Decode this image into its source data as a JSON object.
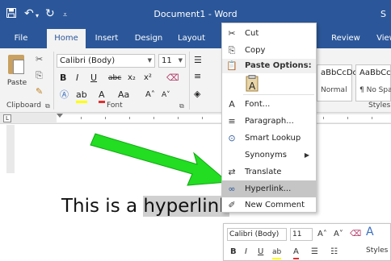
{
  "titlebar": {
    "title": "Document1  -  Word",
    "right_text": "S",
    "save_icon": "save-icon",
    "undo_icon": "undo-icon",
    "redo_icon": "redo-icon",
    "customize_icon": "customize-qat-icon"
  },
  "tabs": [
    {
      "label": "File",
      "active": false
    },
    {
      "label": "Home",
      "active": true
    },
    {
      "label": "Insert",
      "active": false
    },
    {
      "label": "Design",
      "active": false
    },
    {
      "label": "Layout",
      "active": false
    },
    {
      "label": "Review",
      "active": false
    },
    {
      "label": "View",
      "active": false
    }
  ],
  "ribbon": {
    "paste_label": "Paste",
    "clipboard_label": "Clipboard",
    "font_name": "Calibri (Body)",
    "font_size": "11",
    "font_label": "Font",
    "bold": "B",
    "italic": "I",
    "underline": "U",
    "strike": "abc",
    "subscript": "x₂",
    "superscript": "x²",
    "grow": "A˄",
    "shrink": "A˅",
    "change_case": "Aa",
    "styles_label": "Styles",
    "style1_sample": "aBbCcDc",
    "style1_name": "Normal",
    "style2_sample": "AaBbCcD",
    "style2_name": "¶ No Spac"
  },
  "document": {
    "text_before": "This is a ",
    "text_selected": "hyperlink",
    "text_after": "."
  },
  "context_menu": {
    "items": [
      {
        "label": "Cut",
        "icon": "✂"
      },
      {
        "label": "Copy",
        "icon": "⎘"
      },
      {
        "label": "Font...",
        "icon": "A"
      },
      {
        "label": "Paragraph...",
        "icon": "≡"
      },
      {
        "label": "Smart Lookup",
        "icon": "⊙"
      },
      {
        "label": "Synonyms",
        "icon": ""
      },
      {
        "label": "Translate",
        "icon": "⇄"
      },
      {
        "label": "Hyperlink...",
        "icon": "∞"
      },
      {
        "label": "New Comment",
        "icon": "✐"
      }
    ],
    "paste_options_label": "Paste Options:",
    "synonyms_arrow": "▶"
  },
  "mini_toolbar": {
    "font_name": "Calibri (Body)",
    "font_size": "11",
    "styles_label": "Styles"
  },
  "colors": {
    "word_blue": "#2b579a",
    "arrow_green": "#22dd22",
    "highlight": "#d0d0d0"
  }
}
